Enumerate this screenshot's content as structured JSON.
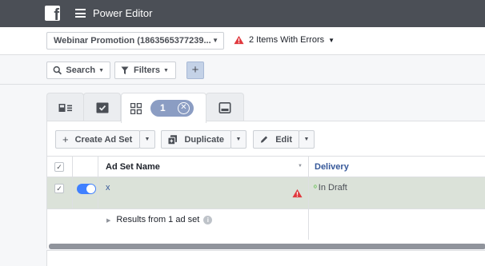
{
  "topbar": {
    "logo_letter": "f",
    "menu_icon": "hamburger-icon",
    "title": "Power Editor"
  },
  "account": {
    "campaign_label": "Webinar Promotion (1863565377239...",
    "errors_label": "2 Items With Errors",
    "colors": {
      "warning": "#e0393e"
    }
  },
  "toolbar": {
    "search_label": "Search",
    "filters_label": "Filters",
    "add_label": "+"
  },
  "tabs": {
    "selected_count": "1",
    "icons": [
      "campaigns-icon",
      "ad-sets-icon",
      "ads-grid-icon",
      "ad-preview-icon"
    ]
  },
  "actions": {
    "create_label": "Create Ad Set",
    "duplicate_label": "Duplicate",
    "edit_label": "Edit"
  },
  "table": {
    "columns": {
      "name": "Ad Set Name",
      "delivery": "Delivery"
    },
    "rows": [
      {
        "name": "x",
        "delivery": "In Draft",
        "has_error": true,
        "active": true
      }
    ],
    "results_text": "Results from 1 ad set"
  },
  "colors": {
    "topbar": "#4b4f56",
    "link": "#365899",
    "toggle_on": "#4080ff",
    "selected_row": "#dbe2d9",
    "selection_pill": "#8b9dc3"
  }
}
